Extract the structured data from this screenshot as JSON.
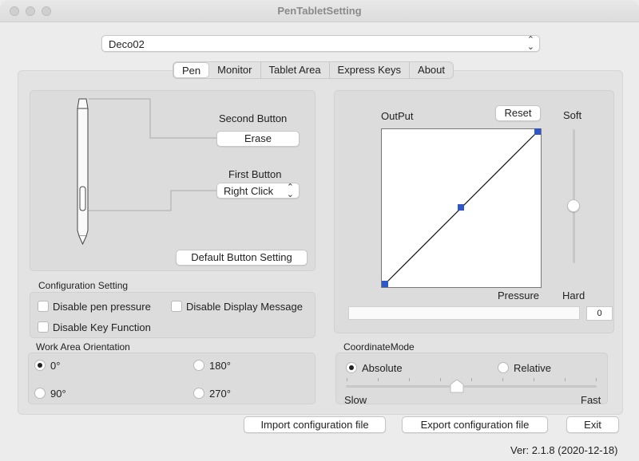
{
  "window": {
    "title": "PenTabletSetting"
  },
  "device": {
    "selected": "Deco02"
  },
  "tabs": [
    {
      "label": "Pen",
      "active": true
    },
    {
      "label": "Monitor"
    },
    {
      "label": "Tablet Area"
    },
    {
      "label": "Express Keys"
    },
    {
      "label": "About"
    }
  ],
  "pen": {
    "second_button_label": "Second Button",
    "second_button_value": "Erase",
    "first_button_label": "First Button",
    "first_button_value": "Right Click",
    "default_button": "Default  Button Setting"
  },
  "config": {
    "title": "Configuration Setting",
    "disable_pressure": "Disable pen pressure",
    "disable_display": "Disable Display Message",
    "disable_key": "Disable Key Function"
  },
  "orientation": {
    "title": "Work Area Orientation",
    "options": [
      "0°",
      "180°",
      "90°",
      "270°"
    ],
    "selected": "0°"
  },
  "pressure": {
    "output_label": "OutPut",
    "reset": "Reset",
    "soft": "Soft",
    "hard": "Hard",
    "pressure_label": "Pressure",
    "value": "0"
  },
  "coordinate": {
    "title": "CoordinateMode",
    "absolute": "Absolute",
    "relative": "Relative",
    "selected": "Absolute",
    "slow": "Slow",
    "fast": "Fast"
  },
  "footer": {
    "import": "Import configuration file",
    "export": "Export configuration file",
    "exit": "Exit",
    "version": "Ver: 2.1.8 (2020-12-18)"
  }
}
